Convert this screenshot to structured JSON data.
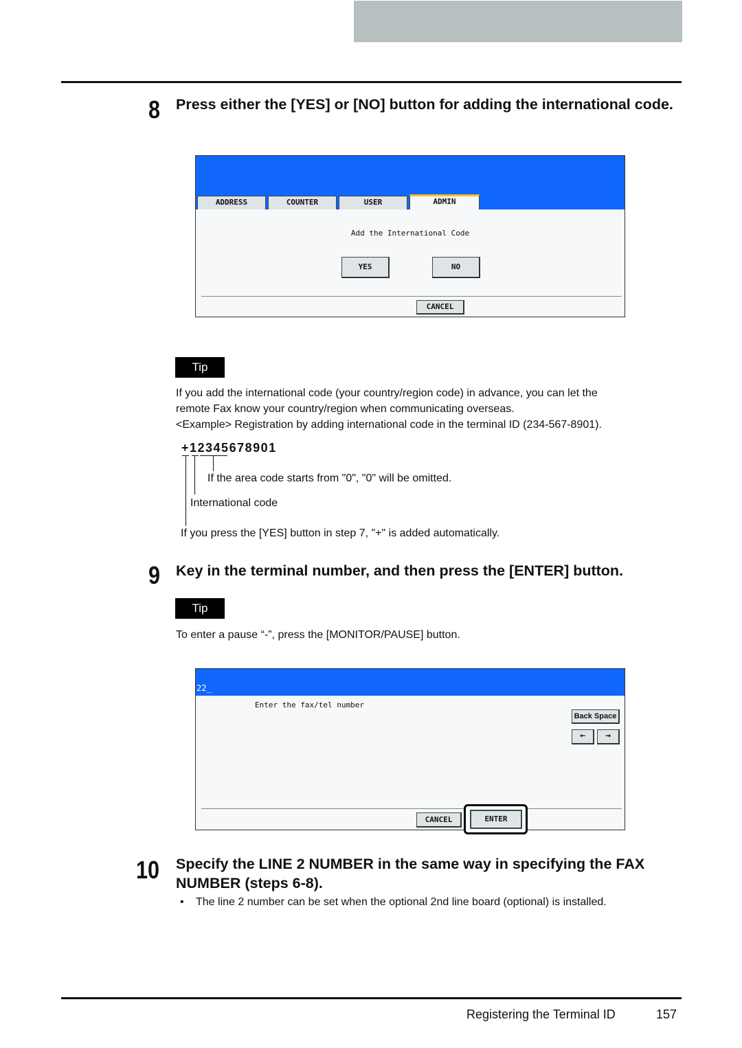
{
  "page": {
    "footer_title": "Registering the Terminal ID",
    "page_number": "157"
  },
  "step8": {
    "number": "8",
    "title": "Press either the [YES] or [NO] button for adding the international code.",
    "panel": {
      "tabs": [
        {
          "label": "ADDRESS",
          "active": false
        },
        {
          "label": "COUNTER",
          "active": false
        },
        {
          "label": "USER",
          "active": false
        },
        {
          "label": "ADMIN",
          "active": true
        }
      ],
      "prompt": "Add the International Code",
      "yes_label": "YES",
      "no_label": "NO",
      "cancel_label": "CANCEL",
      "topbar_color": "#1167fb",
      "active_tab_accent": "#f2c230"
    },
    "tip": {
      "label": "Tip",
      "lines": [
        "If you add the international code (your country/region code) in advance, you can let the",
        "remote Fax know your country/region when communicating overseas.",
        "<Example> Registration by adding international code in the terminal ID (234-567-8901)."
      ],
      "example_number": "+12345678901",
      "annotation_area": "If the area code starts from \"0\", \"0\" will be omitted.",
      "annotation_intl": "International code",
      "annotation_plus": "If you press the [YES] button in step 7, \"+\" is added automatically."
    }
  },
  "step9": {
    "number": "9",
    "title": "Key in the terminal number, and then press the [ENTER] button.",
    "tip": {
      "label": "Tip",
      "text": "To enter a pause “-”, press the [MONITOR/PAUSE] button."
    },
    "panel": {
      "input_value": "22_",
      "prompt": "Enter the fax/tel number",
      "backspace_label": "Back Space",
      "left_arrow": "←",
      "right_arrow": "→",
      "cancel_label": "CANCEL",
      "enter_label": "ENTER"
    }
  },
  "step10": {
    "number": "10",
    "title_line1": "Specify the LINE 2 NUMBER in the same way in specifying the FAX",
    "title_line2": "NUMBER (steps 6-8).",
    "bullet": "•",
    "note": "The line 2 number can be set when the optional 2nd line board (optional) is installed."
  }
}
